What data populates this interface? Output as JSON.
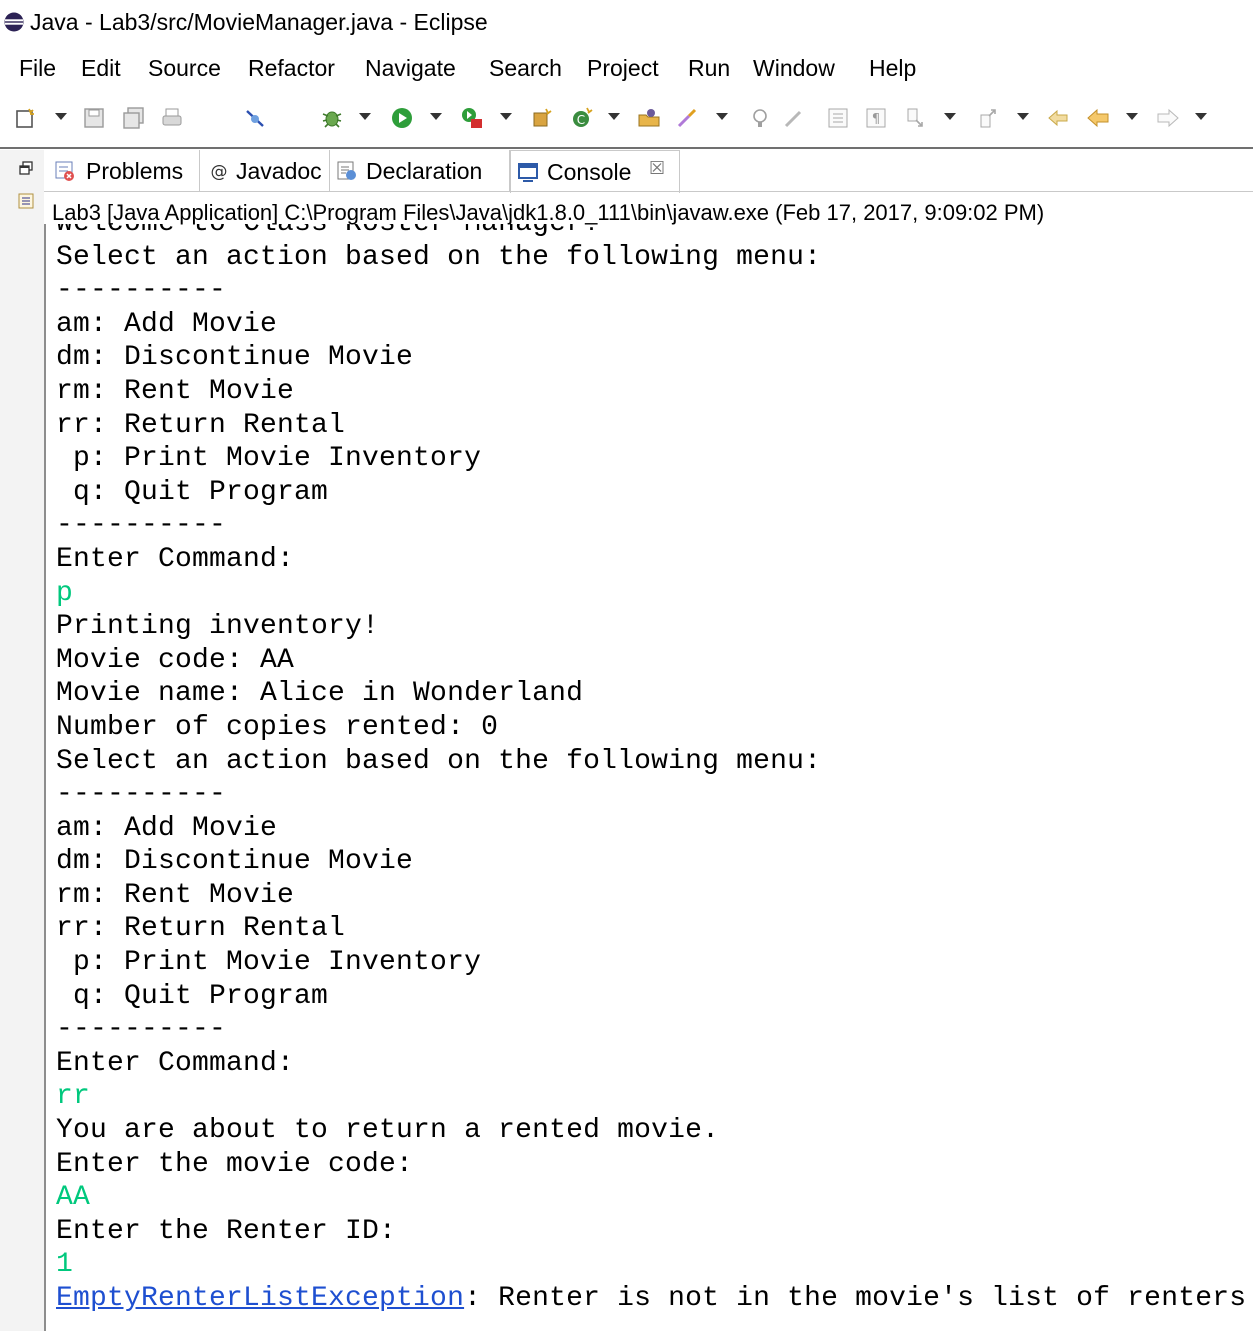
{
  "window": {
    "title": "Java - Lab3/src/MovieManager.java - Eclipse"
  },
  "menubar": {
    "items": [
      "File",
      "Edit",
      "Source",
      "Refactor",
      "Navigate",
      "Search",
      "Project",
      "Run",
      "Window",
      "Help"
    ]
  },
  "tabs": [
    {
      "label": "Problems",
      "icon": "problems-icon"
    },
    {
      "label": "Javadoc",
      "icon": "at-sign-icon"
    },
    {
      "label": "Declaration",
      "icon": "declaration-icon"
    },
    {
      "label": "Console",
      "icon": "console-icon",
      "active": true
    }
  ],
  "console": {
    "header": "Lab3 [Java Application] C:\\Program Files\\Java\\jdk1.8.0_111\\bin\\javaw.exe (Feb 17, 2017, 9:09:02 PM)",
    "input_color": "#00c87d",
    "exception_color": "#1e4fd0",
    "lines": [
      {
        "text": "Welcome to Class Roster Manager!",
        "type": "out"
      },
      {
        "text": "Select an action based on the following menu:",
        "type": "out"
      },
      {
        "text": "----------",
        "type": "out"
      },
      {
        "text": "am: Add Movie",
        "type": "out"
      },
      {
        "text": "dm: Discontinue Movie",
        "type": "out"
      },
      {
        "text": "rm: Rent Movie",
        "type": "out"
      },
      {
        "text": "rr: Return Rental",
        "type": "out"
      },
      {
        "text": " p: Print Movie Inventory",
        "type": "out"
      },
      {
        "text": " q: Quit Program",
        "type": "out"
      },
      {
        "text": "----------",
        "type": "out"
      },
      {
        "text": "Enter Command:",
        "type": "out"
      },
      {
        "text": "p",
        "type": "in"
      },
      {
        "text": "Printing inventory!",
        "type": "out"
      },
      {
        "text": "Movie code: AA",
        "type": "out"
      },
      {
        "text": "Movie name: Alice in Wonderland",
        "type": "out"
      },
      {
        "text": "Number of copies rented: 0",
        "type": "out"
      },
      {
        "text": "Select an action based on the following menu:",
        "type": "out"
      },
      {
        "text": "----------",
        "type": "out"
      },
      {
        "text": "am: Add Movie",
        "type": "out"
      },
      {
        "text": "dm: Discontinue Movie",
        "type": "out"
      },
      {
        "text": "rm: Rent Movie",
        "type": "out"
      },
      {
        "text": "rr: Return Rental",
        "type": "out"
      },
      {
        "text": " p: Print Movie Inventory",
        "type": "out"
      },
      {
        "text": " q: Quit Program",
        "type": "out"
      },
      {
        "text": "----------",
        "type": "out"
      },
      {
        "text": "Enter Command:",
        "type": "out"
      },
      {
        "text": "rr",
        "type": "in"
      },
      {
        "text": "You are about to return a rented movie.",
        "type": "out"
      },
      {
        "text": "Enter the movie code:",
        "type": "out"
      },
      {
        "text": "AA",
        "type": "in"
      },
      {
        "text": "Enter the Renter ID:",
        "type": "out"
      },
      {
        "text": "1",
        "type": "in"
      },
      {
        "type": "exception",
        "exception": "EmptyRenterListException",
        "text": ": Renter is not in the movie's list of renters."
      }
    ]
  }
}
